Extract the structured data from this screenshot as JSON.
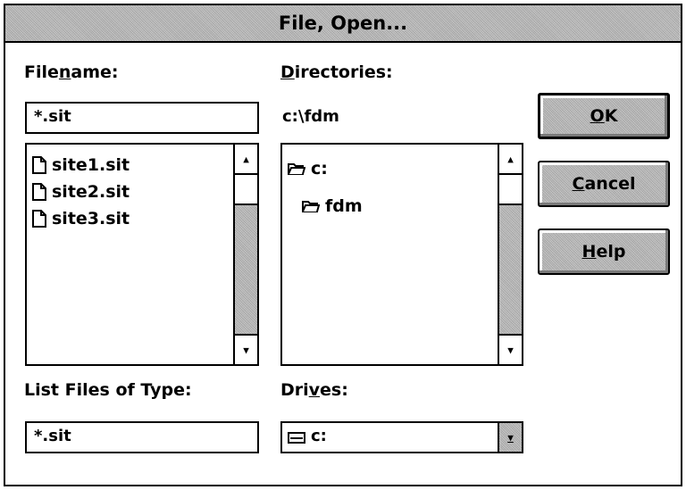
{
  "title": "File, Open...",
  "filename": {
    "label_before": "File",
    "label_accel": "n",
    "label_after": "ame:",
    "value": "*.sit",
    "files": [
      "site1.sit",
      "site2.sit",
      "site3.sit"
    ]
  },
  "directories": {
    "label_accel": "D",
    "label_after": "irectories:",
    "current_path": "c:\\fdm",
    "tree": [
      {
        "name": "c:",
        "icon": "open-folder-icon"
      },
      {
        "name": "fdm",
        "icon": "open-folder-icon"
      }
    ]
  },
  "file_type": {
    "label": "List Files of Type:",
    "value": "*.sit"
  },
  "drives": {
    "label_before": "Dri",
    "label_accel": "v",
    "label_after": "es:",
    "value": "c:",
    "icon": "drive-icon"
  },
  "buttons": {
    "ok": {
      "accel": "O",
      "rest": "K"
    },
    "cancel": {
      "accel": "C",
      "rest": "ancel"
    },
    "help": {
      "accel": "H",
      "rest": "elp"
    }
  },
  "scroll_icons": {
    "up": "▲",
    "down": "▼"
  }
}
